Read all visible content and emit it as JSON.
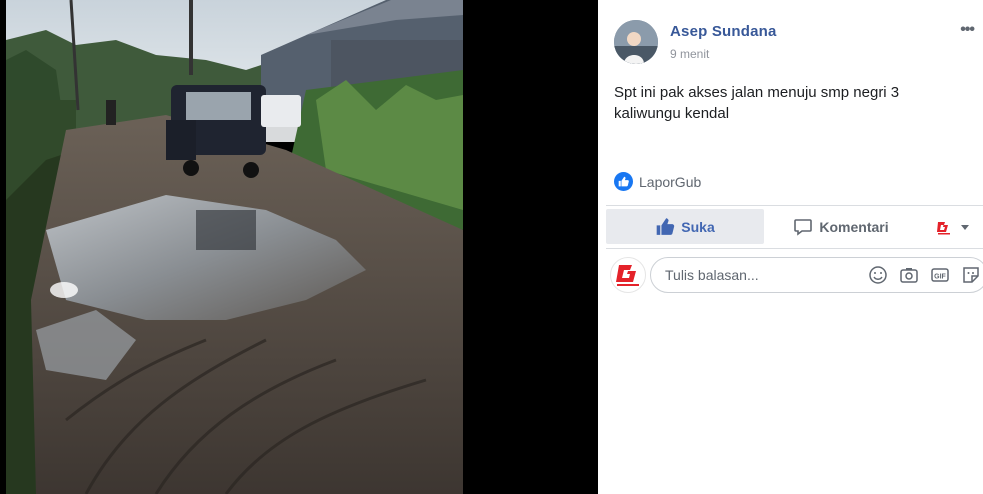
{
  "post": {
    "author": "Asep Sundana",
    "time": "9 menit",
    "more_icon": "•••",
    "text": "Spt ini pak akses jalan menuju smp negri 3 kaliwungu kendal",
    "reaction_name": "LaporGub",
    "reaction_icon": "like-icon"
  },
  "actions": {
    "like_label": "Suka",
    "comment_label": "Komentari"
  },
  "reply": {
    "placeholder": "Tulis balasan...",
    "avatar_brand": "LaporGub",
    "icons": [
      "emoji-icon",
      "camera-icon",
      "gif-icon",
      "sticker-icon"
    ],
    "gif_text": "GIF"
  },
  "colors": {
    "link_blue": "#385898",
    "like_blue": "#4267b2",
    "badge_blue": "#1877f2",
    "brand_red": "#e4222a"
  }
}
